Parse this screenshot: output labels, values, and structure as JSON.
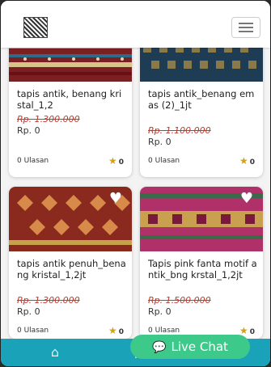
{
  "header": {
    "logo_icon": "pattern-logo-icon",
    "menu_icon": "hamburger-icon"
  },
  "products": [
    {
      "title": "tapis antik, benang kristal_1,2",
      "old_price": "Rp. 1.300.000",
      "price": "Rp. 0",
      "reviews": "0 Ulasan",
      "rating": "0"
    },
    {
      "title": "tapis antik_benang emas (2)_1jt",
      "old_price": "Rp. 1.100.000",
      "price": "Rp. 0",
      "reviews": "0 Ulasan",
      "rating": "0"
    },
    {
      "title": "tapis antik penuh_benang kristal_1,2jt",
      "old_price": "Rp. 1.300.000",
      "price": "Rp. 0",
      "reviews": "0 Ulasan",
      "rating": "0"
    },
    {
      "title": "Tapis pink fanta motif antik_bng krstal_1,2jt",
      "old_price": "Rp. 1.500.000",
      "price": "Rp. 0",
      "reviews": "0 Ulasan",
      "rating": "0"
    }
  ],
  "live_chat": {
    "label": "Live Chat"
  },
  "colors": {
    "accent": "#1aa3b8",
    "live_chat": "#3cc98a",
    "sale": "#c0392b",
    "star": "#d4a017"
  }
}
